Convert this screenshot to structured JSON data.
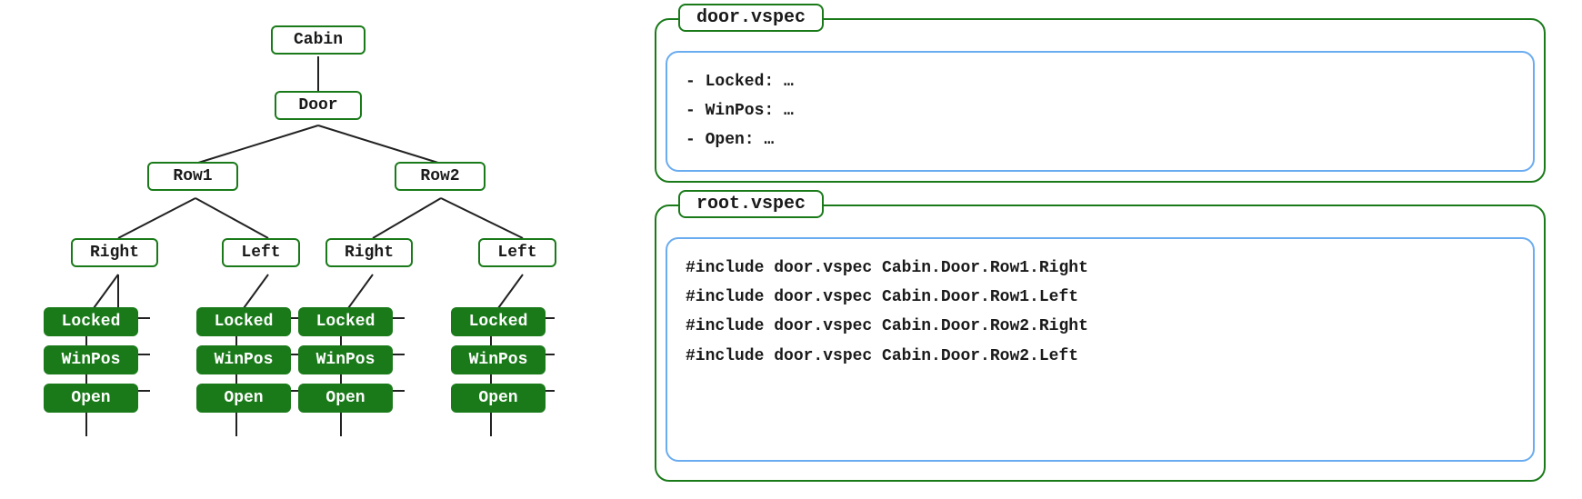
{
  "tree": {
    "nodes": {
      "cabin": "Cabin",
      "door": "Door",
      "row1": "Row1",
      "row2": "Row2",
      "r1_right": "Right",
      "r1_left": "Left",
      "r2_right": "Right",
      "r2_left": "Left",
      "r1r_locked": "Locked",
      "r1r_winpos": "WinPos",
      "r1r_open": "Open",
      "r1l_locked": "Locked",
      "r1l_winpos": "WinPos",
      "r1l_open": "Open",
      "r2r_locked": "Locked",
      "r2r_winpos": "WinPos",
      "r2r_open": "Open",
      "r2l_locked": "Locked",
      "r2l_winpos": "WinPos",
      "r2l_open": "Open"
    }
  },
  "door_vspec": {
    "title": "door.vspec",
    "lines": [
      "- Locked: …",
      "- WinPos: …",
      "- Open: …"
    ]
  },
  "root_vspec": {
    "title": "root.vspec",
    "lines": [
      "#include door.vspec Cabin.Door.Row1.Right",
      "#include door.vspec Cabin.Door.Row1.Left",
      "#include door.vspec Cabin.Door.Row2.Right",
      "#include door.vspec Cabin.Door.Row2.Left"
    ]
  }
}
